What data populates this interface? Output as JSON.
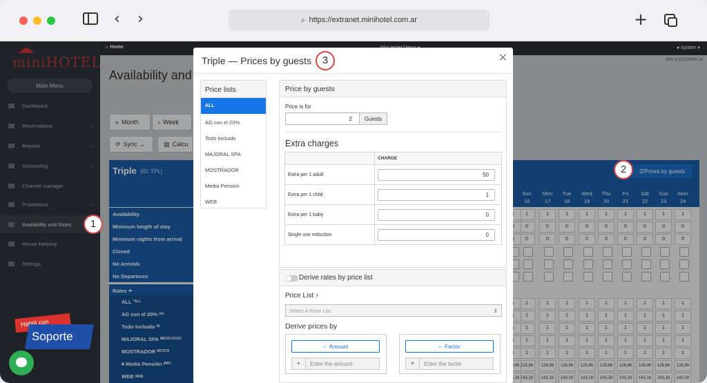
{
  "browser": {
    "url": "https://extranet.minihotel.com.ar"
  },
  "topbar": {
    "home": "Home",
    "hotel": "Mini Hotel Demo",
    "user": "system",
    "version": "MW V-20220909-16"
  },
  "logo": {
    "text": "miniHOTEL"
  },
  "sidebar": {
    "main_menu": "Main Menu",
    "items": [
      {
        "label": "Dashboard",
        "icon": "dashboard-icon"
      },
      {
        "label": "Reservations",
        "icon": "reservations-icon"
      },
      {
        "label": "Reports",
        "icon": "reports-icon"
      },
      {
        "label": "Accounting",
        "icon": "accounting-icon"
      },
      {
        "label": "Channel manager",
        "icon": "channel-icon"
      },
      {
        "label": "Promotions",
        "icon": "promotions-icon"
      },
      {
        "label": "Availability and Rates",
        "icon": "calendar-icon"
      },
      {
        "label": "House keeping",
        "icon": "broom-icon"
      },
      {
        "label": "Settings",
        "icon": "gear-icon"
      }
    ]
  },
  "support": {
    "hab": "Hablá con",
    "sop": "Soporte"
  },
  "page": {
    "title": "Availability and",
    "month": "Month",
    "week": "Week",
    "sync": "Sync",
    "calc": "Calcu"
  },
  "room": {
    "name": "Triple",
    "id": "(ID: TPL)",
    "prices_btn": "Prices by guests"
  },
  "grid": {
    "days": [
      {
        "d": "Sun",
        "n": "16"
      },
      {
        "d": "Mon",
        "n": "17"
      },
      {
        "d": "Tue",
        "n": "18"
      },
      {
        "d": "Wed",
        "n": "19"
      },
      {
        "d": "Thu",
        "n": "20"
      },
      {
        "d": "Fri",
        "n": "21"
      },
      {
        "d": "Sat",
        "n": "22"
      },
      {
        "d": "Sun",
        "n": "23"
      },
      {
        "d": "Mon",
        "n": "24"
      }
    ],
    "rows": [
      "Availability",
      "Minimum length of stay",
      "Minimum nights from arrival",
      "Closed",
      "No Arrivals",
      "No Departures"
    ],
    "rates_label": "Rates",
    "rates": [
      {
        "name": "ALL",
        "code": "*ALL"
      },
      {
        "name": "AG con el 20%",
        "code": "AG"
      },
      {
        "name": "Todo Incluido",
        "code": "AI"
      },
      {
        "name": "MAJORAL SPA",
        "code": "MEXICO2022"
      },
      {
        "name": "MOSTRADOR",
        "code": "MOSTR"
      },
      {
        "name": "Media Pensión",
        "code": "(MP)"
      },
      {
        "name": "WEB",
        "code": "WEB"
      }
    ],
    "one": "1",
    "zero": "0",
    "p1": "128,86",
    "p2": "143,16"
  },
  "badges": {
    "b1": "1",
    "b2": "2",
    "b3": "3"
  },
  "modal": {
    "title": "Triple — Prices by guests",
    "price_lists_head": "Price lists",
    "price_lists": [
      "ALL",
      "AG con el 20%",
      "Todo Incluido",
      "MAJORAL SPA",
      "MOSTRADOR",
      "Media Pensión",
      "WEB"
    ],
    "pg_head": "Price by guests",
    "price_for_label": "Price is for",
    "guests_value": "2",
    "guests_addon": "Guests",
    "extra_title": "Extra charges",
    "charge_head": "CHARGE",
    "extras": [
      {
        "label": "Extra per 1 adult",
        "value": "50"
      },
      {
        "label": "Extra per 1 child",
        "value": "1"
      },
      {
        "label": "Extra per 1 baby",
        "value": "0"
      },
      {
        "label": "Single use reduction",
        "value": "0"
      }
    ],
    "derive_head": "Derive rates by price list",
    "price_list_label": "Price List",
    "price_list_placeholder": "Select A Price List",
    "derive_by": "Derive prices by",
    "amount": "Amount",
    "amount_placeholder": "Enter the amount",
    "factor": "Factor",
    "factor_placeholder": "Enter the factor"
  }
}
